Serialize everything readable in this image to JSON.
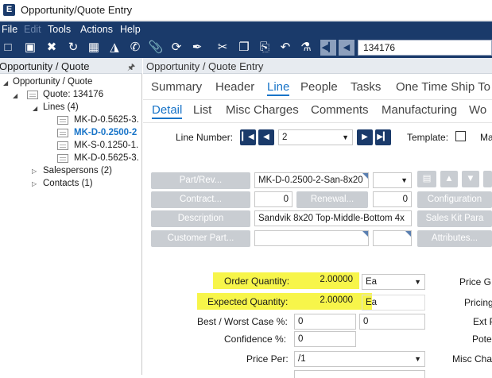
{
  "window": {
    "title": "Opportunity/Quote Entry",
    "logo": "E"
  },
  "menu": [
    "File",
    "Edit",
    "Tools",
    "Actions",
    "Help"
  ],
  "toolbar": {
    "icons": [
      "new-icon",
      "save-icon",
      "delete-icon",
      "refresh-icon",
      "grid-icon",
      "open-folder-icon",
      "phone-icon",
      "attachment-icon",
      "sync-icon",
      "broom-icon",
      "cut-icon",
      "copy-icon",
      "paste-icon",
      "undo-icon",
      "search-people-icon"
    ],
    "search_value": "134176"
  },
  "tree": {
    "title": "Opportunity / Quote",
    "root": "Opportunity / Quote",
    "quote": "Quote: 134176",
    "lines_label": "Lines (4)",
    "lines": [
      "MK-D-0.5625-3.",
      "MK-D-0.2500-2",
      "MK-S-0.1250-1.",
      "MK-D-0.5625-3."
    ],
    "salespersons": "Salespersons (2)",
    "contacts": "Contacts (1)"
  },
  "main": {
    "title": "Opportunity / Quote Entry",
    "tabs": [
      "Summary",
      "Header",
      "Line",
      "People",
      "Tasks",
      "One Time Ship To"
    ],
    "subtabs": [
      "Detail",
      "List",
      "Misc Charges",
      "Comments",
      "Manufacturing",
      "Wo"
    ],
    "line_number_label": "Line Number:",
    "line_number_value": "2",
    "template_label": "Template:",
    "cut_label": "Ma",
    "buttons": {
      "part_rev": "Part/Rev...",
      "contract": "Contract...",
      "renewal": "Renewal...",
      "description": "Description",
      "customer_part": "Customer Part...",
      "configuration": "Configuration",
      "sales_kit": "Sales Kit Para",
      "attributes": "Attributes..."
    },
    "fields": {
      "part_value": "MK-D-0.2500-2-San-8x20",
      "contract_value": "0",
      "renewal_value": "0",
      "description_value": "Sandvik  8x20  Top-Middle-Bottom 4x"
    },
    "quantities": {
      "order_label": "Order Quantity:",
      "order_value": "2.00000",
      "order_uom": "Ea",
      "expected_label": "Expected Quantity:",
      "expected_value": "2.00000",
      "expected_uom": "Ea",
      "best_worst_label": "Best / Worst Case %:",
      "best_value": "0",
      "worst_value": "0",
      "confidence_label": "Confidence %:",
      "confidence_value": "0",
      "price_per_label": "Price Per:",
      "price_per_value": "/1"
    },
    "right_labels": [
      "Price G",
      "Pricing",
      "Ext P",
      "Pote",
      "Misc Cha"
    ]
  }
}
